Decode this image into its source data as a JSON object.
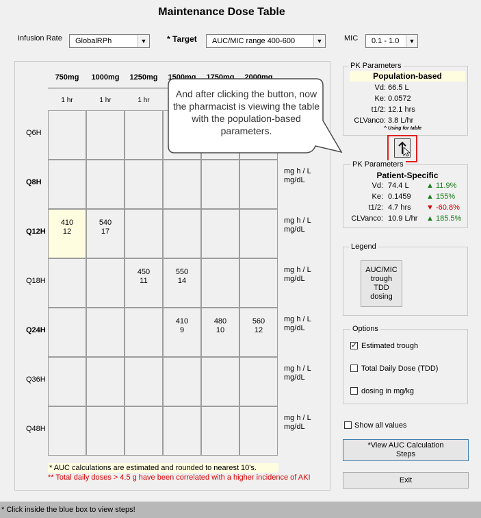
{
  "window": {
    "title": "Maintenance Dose Table"
  },
  "top_controls": {
    "infusion_rate": {
      "label": "Infusion Rate",
      "value": "GlobalRPh"
    },
    "target": {
      "label": "* Target",
      "value": "AUC/MIC range 400-600"
    },
    "mic": {
      "label": "MIC",
      "value": "0.1 - 1.0"
    }
  },
  "dose_table": {
    "columns": [
      {
        "dose": "750mg",
        "infusion": "1 hr"
      },
      {
        "dose": "1000mg",
        "infusion": "1 hr"
      },
      {
        "dose": "1250mg",
        "infusion": "1 hr"
      },
      {
        "dose": "1500mg",
        "infusion": ""
      },
      {
        "dose": "1750mg",
        "infusion": ""
      },
      {
        "dose": "2000mg",
        "infusion": ""
      }
    ],
    "rows": [
      {
        "interval": "Q6H",
        "bold": false,
        "cells": [
          [
            "",
            ""
          ],
          [
            "",
            ""
          ],
          [
            "",
            ""
          ],
          [
            "",
            ""
          ],
          [
            "",
            ""
          ],
          [
            "",
            ""
          ]
        ],
        "units": [
          "",
          ""
        ]
      },
      {
        "interval": "Q8H",
        "bold": true,
        "cells": [
          [
            "",
            ""
          ],
          [
            "",
            ""
          ],
          [
            "",
            ""
          ],
          [
            "",
            ""
          ],
          [
            "",
            ""
          ],
          [
            "",
            ""
          ]
        ],
        "units": [
          "mg h / L",
          "mg/dL"
        ]
      },
      {
        "interval": "Q12H",
        "bold": true,
        "cells": [
          [
            "410",
            "12"
          ],
          [
            "540",
            "17"
          ],
          [
            "",
            ""
          ],
          [
            "",
            ""
          ],
          [
            "",
            ""
          ],
          [
            "",
            ""
          ]
        ],
        "units": [
          "mg h / L",
          "mg/dL"
        ]
      },
      {
        "interval": "Q18H",
        "bold": false,
        "cells": [
          [
            "",
            ""
          ],
          [
            "",
            ""
          ],
          [
            "450",
            "11"
          ],
          [
            "550",
            "14"
          ],
          [
            "",
            ""
          ],
          [
            "",
            ""
          ]
        ],
        "units": [
          "mg h / L",
          "mg/dL"
        ]
      },
      {
        "interval": "Q24H",
        "bold": true,
        "cells": [
          [
            "",
            ""
          ],
          [
            "",
            ""
          ],
          [
            "",
            ""
          ],
          [
            "410",
            "9"
          ],
          [
            "480",
            "10"
          ],
          [
            "560",
            "12"
          ]
        ],
        "units": [
          "mg h / L",
          "mg/dL"
        ]
      },
      {
        "interval": "Q36H",
        "bold": false,
        "cells": [
          [
            "",
            ""
          ],
          [
            "",
            ""
          ],
          [
            "",
            ""
          ],
          [
            "",
            ""
          ],
          [
            "",
            ""
          ],
          [
            "",
            ""
          ]
        ],
        "units": [
          "mg h / L",
          "mg/dL"
        ]
      },
      {
        "interval": "Q48H",
        "bold": false,
        "cells": [
          [
            "",
            ""
          ],
          [
            "",
            ""
          ],
          [
            "",
            ""
          ],
          [
            "",
            ""
          ],
          [
            "",
            ""
          ],
          [
            "",
            ""
          ]
        ],
        "units": [
          "mg h / L",
          "mg/dL"
        ]
      }
    ],
    "highlight_cell": "Q12H-750mg",
    "footnote_auc": "* AUC calculations are estimated and rounded to nearest 10's.",
    "footnote_aki": "** Total daily doses > 4.5 g have been correlated with a higher incidence of AKI"
  },
  "callout": {
    "text": "And after clicking the button, now the pharmacist is viewing the table with the population-based parameters."
  },
  "pk_population": {
    "title": "PK Parameters",
    "header": "Population-based",
    "rows": [
      {
        "label": "Vd:",
        "value": "66.5 L"
      },
      {
        "label": "Ke:",
        "value": "0.0572"
      },
      {
        "label": "t1/2:",
        "value": "12.1 hrs"
      },
      {
        "label": "CLVanco:",
        "value": "3.8 L/hr"
      }
    ],
    "using_note": "^ Using for table"
  },
  "toggle_button": {
    "icon": "up-arrow-icon"
  },
  "pk_patient": {
    "title": "PK Parameters",
    "header": "Patient-Specific",
    "rows": [
      {
        "label": "Vd:",
        "value": "74.4 L",
        "change": "11.9%",
        "dir": "up"
      },
      {
        "label": "Ke:",
        "value": "0.1459",
        "change": "155%",
        "dir": "up"
      },
      {
        "label": "t1/2:",
        "value": "4.7 hrs",
        "change": "-60.8%",
        "dir": "down"
      },
      {
        "label": "CLVanco:",
        "value": "10.9 L/hr",
        "change": "185.5%",
        "dir": "up"
      }
    ]
  },
  "legend": {
    "title": "Legend",
    "lines": [
      "AUC/MIC",
      "trough",
      "TDD",
      "dosing"
    ]
  },
  "options": {
    "title": "Options",
    "items": [
      {
        "label": "Estimated trough",
        "checked": true
      },
      {
        "label": "Total Daily  Dose (TDD)",
        "checked": false
      },
      {
        "label": "dosing in mg/kg",
        "checked": false
      }
    ]
  },
  "show_all": {
    "label": "Show all values",
    "checked": false
  },
  "view_auc_button": {
    "line1": "*View AUC Calculation",
    "line2": "Steps"
  },
  "exit_button": {
    "label": "Exit"
  },
  "status_bar": {
    "text": "* Click inside the blue box to view steps!"
  },
  "colors": {
    "accent_border": "#3c7fb1",
    "highlight": "#fffde0",
    "green": "#1b7d1b",
    "red": "#d50000",
    "callout_marker": "#e02020"
  }
}
